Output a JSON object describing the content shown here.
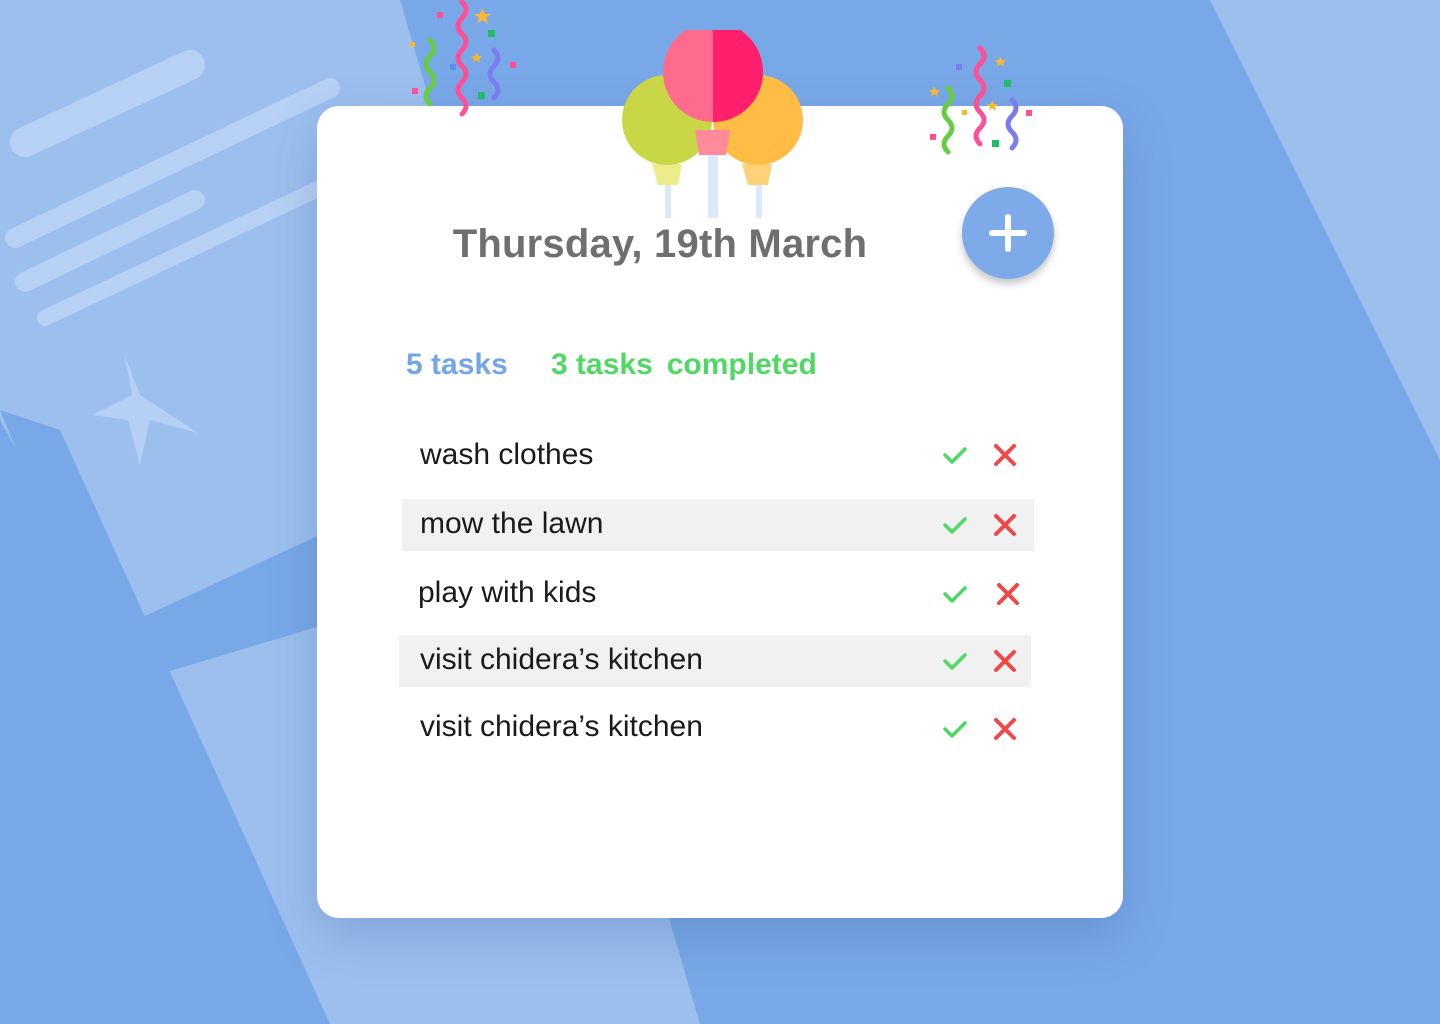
{
  "header": {
    "date_title": "Thursday, 19th March"
  },
  "stats": {
    "total_count": "5 tasks",
    "completed_count": "3 tasks",
    "completed_word": "completed"
  },
  "tasks": [
    {
      "label": "wash clothes",
      "shaded": false
    },
    {
      "label": "mow the lawn",
      "shaded": true
    },
    {
      "label": "play with kids",
      "shaded": false
    },
    {
      "label": "visit chidera’s kitchen",
      "shaded": true
    },
    {
      "label": "visit chidera’s kitchen",
      "shaded": false
    }
  ],
  "icons": {
    "add": "plus-icon",
    "complete": "check-icon",
    "delete": "close-icon",
    "decoration": [
      "balloons-icon",
      "confetti-icon",
      "star-icon"
    ]
  },
  "colors": {
    "background": "#79a8e8",
    "accent_blue": "#74a6e6",
    "success_green": "#4fd964",
    "danger_red": "#f04848",
    "title_gray": "#6f6f6f"
  }
}
